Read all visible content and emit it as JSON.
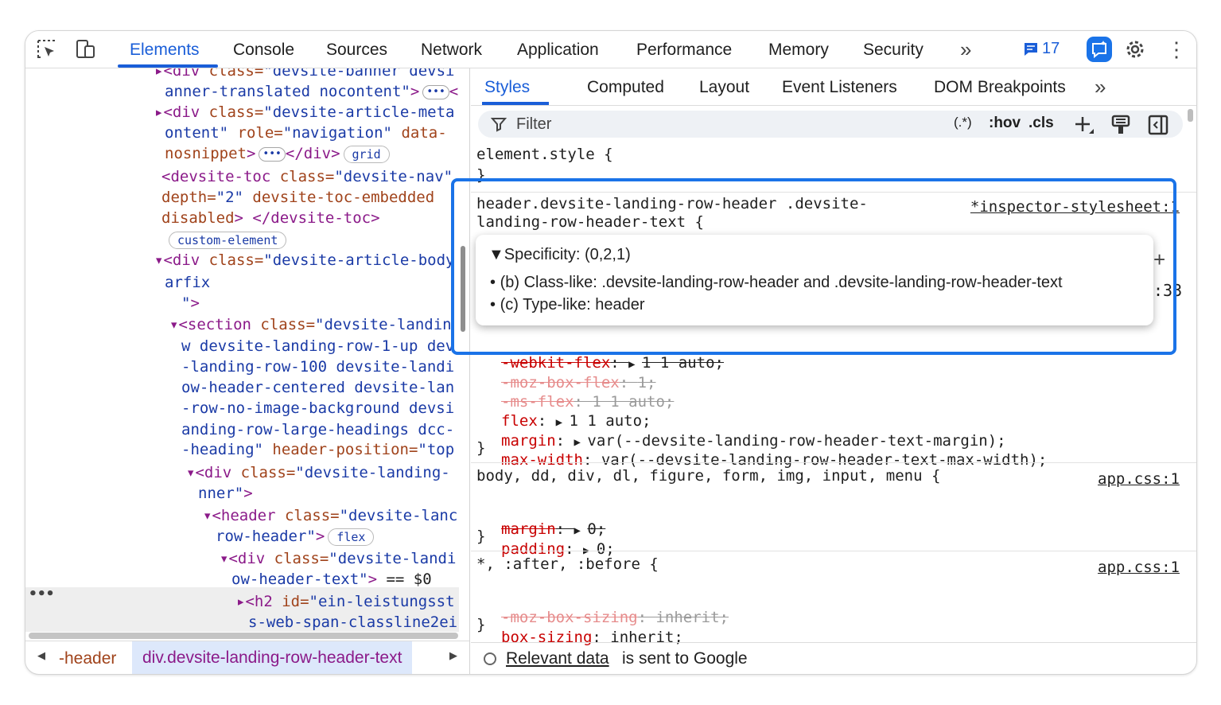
{
  "toolbar": {
    "tabs": [
      "Elements",
      "Console",
      "Sources",
      "Network",
      "Application",
      "Performance",
      "Memory",
      "Security"
    ],
    "more": "»",
    "issues_count": "17"
  },
  "dom": {
    "lines": [
      {
        "parts": [
          [
            "tag",
            "▸<div "
          ],
          [
            "an",
            "class="
          ],
          [
            "av",
            "\"devsite-banner devsi"
          ]
        ]
      },
      {
        "parts": [
          [
            "av",
            "anner-translated nocontent\""
          ],
          [
            "tag",
            ">"
          ],
          [
            "ell",
            "•••"
          ],
          [
            "tag",
            "<"
          ]
        ]
      },
      {
        "parts": [
          [
            "tag",
            "▸<div "
          ],
          [
            "an",
            "class="
          ],
          [
            "av",
            "\"devsite-article-meta"
          ]
        ]
      },
      {
        "parts": [
          [
            "av",
            "ontent\" "
          ],
          [
            "an",
            "role="
          ],
          [
            "av",
            "\"navigation\" "
          ],
          [
            "an",
            "data-"
          ]
        ]
      },
      {
        "parts": [
          [
            "an",
            "nosnippet"
          ],
          [
            "tag",
            ">"
          ],
          [
            "ell",
            "•••"
          ],
          [
            "tag",
            "</div>"
          ],
          [
            "pill",
            "grid"
          ]
        ]
      },
      {
        "parts": [
          [
            "tag",
            "<devsite-toc "
          ],
          [
            "an",
            "class="
          ],
          [
            "av",
            "\"devsite-nav\""
          ]
        ]
      },
      {
        "parts": [
          [
            "an",
            "depth="
          ],
          [
            "av",
            "\"2\" "
          ],
          [
            "an",
            "devsite-toc-embedded"
          ]
        ]
      },
      {
        "parts": [
          [
            "an",
            "disabled"
          ],
          [
            "tag",
            "> </devsite-toc>"
          ]
        ]
      },
      {
        "parts": [
          [
            "pill",
            "custom-element"
          ]
        ]
      },
      {
        "parts": [
          [
            "tag",
            "▾<div "
          ],
          [
            "an",
            "class="
          ],
          [
            "av",
            "\"devsite-article-body"
          ]
        ]
      },
      {
        "parts": [
          [
            "av",
            "arfix"
          ]
        ]
      },
      {
        "parts": [
          [
            "av",
            "  \""
          ],
          [
            "tag",
            ">"
          ]
        ]
      },
      {
        "parts": [
          [
            "tag",
            "▾<section "
          ],
          [
            "an",
            "class="
          ],
          [
            "av",
            "\"devsite-landin"
          ]
        ]
      },
      {
        "parts": [
          [
            "av",
            "w devsite-landing-row-1-up dev"
          ]
        ]
      },
      {
        "parts": [
          [
            "av",
            "-landing-row-100 devsite-landi"
          ]
        ]
      },
      {
        "parts": [
          [
            "av",
            "ow-header-centered devsite-lan"
          ]
        ]
      },
      {
        "parts": [
          [
            "av",
            "-row-no-image-background devsi"
          ]
        ]
      },
      {
        "parts": [
          [
            "av",
            "anding-row-large-headings dcc-"
          ]
        ]
      },
      {
        "parts": [
          [
            "av",
            "-heading\" "
          ],
          [
            "an",
            "header-position="
          ],
          [
            "av",
            "\"top"
          ]
        ]
      },
      {
        "parts": [
          [
            "tag",
            "▾<div "
          ],
          [
            "an",
            "class="
          ],
          [
            "av",
            "\"devsite-landing-"
          ]
        ]
      },
      {
        "parts": [
          [
            "av",
            "nner\""
          ],
          [
            "tag",
            ">"
          ]
        ]
      },
      {
        "parts": [
          [
            "tag",
            "▾<header "
          ],
          [
            "an",
            "class="
          ],
          [
            "av",
            "\"devsite-lanc"
          ]
        ]
      },
      {
        "parts": [
          [
            "av",
            "row-header\""
          ],
          [
            "tag",
            ">"
          ],
          [
            "pill",
            "flex"
          ]
        ]
      },
      {
        "parts": [
          [
            "tag",
            "▾<div "
          ],
          [
            "an",
            "class="
          ],
          [
            "av",
            "\"devsite-landi"
          ]
        ]
      },
      {
        "parts": [
          [
            "av",
            "ow-header-text\""
          ],
          [
            "tag",
            ">"
          ],
          [
            "tx",
            " == $0"
          ]
        ]
      },
      {
        "parts": [
          [
            "tag",
            "▸<h2 "
          ],
          [
            "an",
            "id="
          ],
          [
            "av",
            "\"ein-leistungsst"
          ]
        ]
      },
      {
        "parts": [
          [
            "av",
            "s-web-span-classline2ei"
          ]
        ]
      }
    ]
  },
  "breadcrumbs": {
    "items": [
      "-header",
      "div.devsite-landing-row-header-text"
    ]
  },
  "styles_tabs": [
    "Styles",
    "Computed",
    "Layout",
    "Event Listeners",
    "DOM Breakpoints"
  ],
  "styles_more": "»",
  "filter": {
    "placeholder": "Filter",
    "regex": "(.*)",
    "hov": ":hov",
    "cls": ".cls"
  },
  "rules": {
    "element_style": "element.style {",
    "close": "}",
    "r1_selector_a": "header.devsite-landing-row-header .devsite-",
    "r1_selector_b": "landing-row-header-text {",
    "r1_source": "*inspector-stylesheet:1",
    "r1_props": [
      {
        "name": "-webkit-flex",
        "value": "1 1 auto;",
        "strike": true,
        "faded": false
      },
      {
        "name": "-moz-box-flex",
        "value": "1;",
        "strike": true,
        "faded": true
      },
      {
        "name": "-ms-flex",
        "value": "1 1 auto;",
        "strike": true,
        "faded": true
      },
      {
        "name": "flex",
        "value": "1 1 auto;",
        "strike": false,
        "faded": false
      },
      {
        "name": "margin",
        "value": "var(--devsite-landing-row-header-text-margin);",
        "strike": false,
        "faded": false
      },
      {
        "name": "max-width",
        "value": "var(--devsite-landing-row-header-text-max-width);",
        "strike": false,
        "faded": false
      }
    ],
    "r2_selector": "body, dd, div, dl, figure, form, img, input, menu {",
    "r2_source": "app.css:1",
    "r2_props": [
      {
        "name": "margin",
        "value": "0;",
        "strike": true
      },
      {
        "name": "padding",
        "value": "0;",
        "strike": false
      }
    ],
    "r3_selector": "*, :after, :before {",
    "r3_source": "app.css:1",
    "r3_props": [
      {
        "name": "-moz-box-sizing",
        "value": "inherit;",
        "strike": true,
        "faded": true
      },
      {
        "name": "box-sizing",
        "value": "inherit;",
        "strike": false,
        "faded": false
      }
    ]
  },
  "tooltip": {
    "title": "Specificity: (0,2,1)",
    "line1": "(b) Class-like: .devsite-landing-row-header and .devsite-landing-row-header-text",
    "line2": "(c) Type-like: header"
  },
  "side_number": ":33",
  "footer": {
    "link": "Relevant data",
    "text": "is sent to Google"
  },
  "colors": {
    "accent": "#1a5ed8",
    "highlight_border": "#1a73e8",
    "tag": "#8b1a89",
    "attr_name": "#a0431b",
    "attr_value": "#1a3aa6",
    "property": "#c80000"
  },
  "icons": [
    "inspect-element-icon",
    "device-toolbar-icon",
    "chevrons-right-icon",
    "issues-icon",
    "ai-assistant-icon",
    "gear-icon",
    "kebab-menu-icon",
    "filter-icon",
    "add-rule-icon",
    "paint-brush-icon",
    "sidebar-toggle-icon",
    "radio-icon"
  ]
}
